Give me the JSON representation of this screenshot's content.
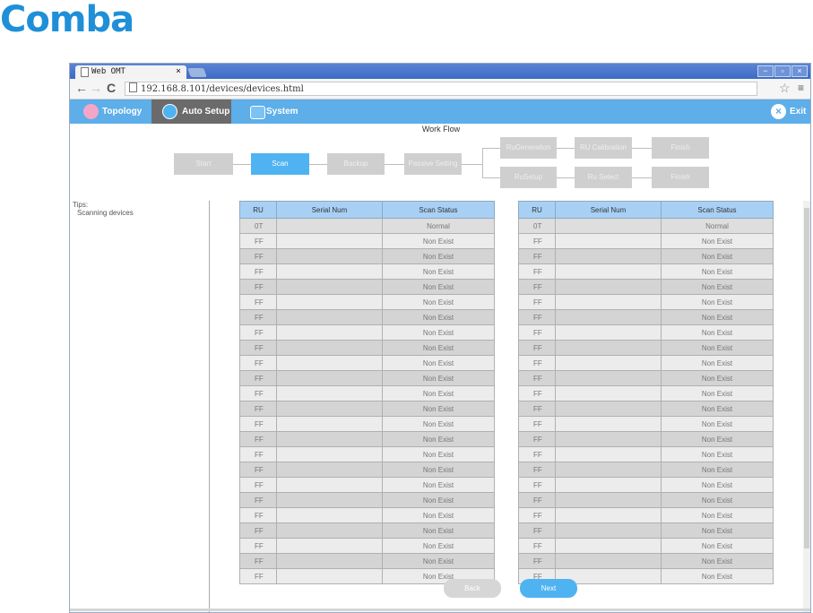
{
  "brand": {
    "logo_text": "Comba",
    "color": "#1f8fd8"
  },
  "browser": {
    "tab_title": "Web OMT",
    "tab_close": "×",
    "url": "192.168.8.101/devices/devices.html",
    "window_buttons": [
      "−",
      "▫",
      "×"
    ]
  },
  "menu": {
    "topology": "Topology",
    "auto_setup": "Auto Setup",
    "system": "System",
    "exit": "Exit"
  },
  "workflow": {
    "title": "Work Flow",
    "steps": {
      "start": "Start",
      "scan": "Scan",
      "backup": "Backup",
      "passive_setting": "Passive Setting",
      "ru_generation": "RuGeneration",
      "ru_calibration": "RU Calibration",
      "finish1": "Finish",
      "ru_setup": "RuSetup",
      "ru_select": "Ru Select",
      "finish2": "Finish"
    }
  },
  "tips": {
    "label": "Tips:",
    "text": "Scanning devices"
  },
  "table_headers": [
    "RU",
    "Serial Num",
    "Scan Status"
  ],
  "left_table": [
    [
      "0T",
      "",
      "Normal"
    ],
    [
      "FF",
      "",
      "Non Exist"
    ],
    [
      "FF",
      "",
      "Non Exist"
    ],
    [
      "FF",
      "",
      "Non Exist"
    ],
    [
      "FF",
      "",
      "Non Exist"
    ],
    [
      "FF",
      "",
      "Non Exist"
    ],
    [
      "FF",
      "",
      "Non Exist"
    ],
    [
      "FF",
      "",
      "Non Exist"
    ],
    [
      "FF",
      "",
      "Non Exist"
    ],
    [
      "FF",
      "",
      "Non Exist"
    ],
    [
      "FF",
      "",
      "Non Exist"
    ],
    [
      "FF",
      "",
      "Non Exist"
    ],
    [
      "FF",
      "",
      "Non Exist"
    ],
    [
      "FF",
      "",
      "Non Exist"
    ],
    [
      "FF",
      "",
      "Non Exist"
    ],
    [
      "FF",
      "",
      "Non Exist"
    ],
    [
      "FF",
      "",
      "Non Exist"
    ],
    [
      "FF",
      "",
      "Non Exist"
    ],
    [
      "FF",
      "",
      "Non Exist"
    ],
    [
      "FF",
      "",
      "Non Exist"
    ],
    [
      "FF",
      "",
      "Non Exist"
    ],
    [
      "FF",
      "",
      "Non Exist"
    ],
    [
      "FF",
      "",
      "Non Exist"
    ],
    [
      "FF",
      "",
      "Non Exist"
    ]
  ],
  "right_table": [
    [
      "0T",
      "",
      "Normal"
    ],
    [
      "FF",
      "",
      "Non Exist"
    ],
    [
      "FF",
      "",
      "Non Exist"
    ],
    [
      "FF",
      "",
      "Non Exist"
    ],
    [
      "FF",
      "",
      "Non Exist"
    ],
    [
      "FF",
      "",
      "Non Exist"
    ],
    [
      "FF",
      "",
      "Non Exist"
    ],
    [
      "FF",
      "",
      "Non Exist"
    ],
    [
      "FF",
      "",
      "Non Exist"
    ],
    [
      "FF",
      "",
      "Non Exist"
    ],
    [
      "FF",
      "",
      "Non Exist"
    ],
    [
      "FF",
      "",
      "Non Exist"
    ],
    [
      "FF",
      "",
      "Non Exist"
    ],
    [
      "FF",
      "",
      "Non Exist"
    ],
    [
      "FF",
      "",
      "Non Exist"
    ],
    [
      "FF",
      "",
      "Non Exist"
    ],
    [
      "FF",
      "",
      "Non Exist"
    ],
    [
      "FF",
      "",
      "Non Exist"
    ],
    [
      "FF",
      "",
      "Non Exist"
    ],
    [
      "FF",
      "",
      "Non Exist"
    ],
    [
      "FF",
      "",
      "Non Exist"
    ],
    [
      "FF",
      "",
      "Non Exist"
    ],
    [
      "FF",
      "",
      "Non Exist"
    ],
    [
      "FF",
      "",
      "Non Exist"
    ]
  ],
  "buttons": {
    "back": "Back",
    "next": "Next"
  },
  "colors": {
    "menubar": "#5daee9",
    "active_step": "#4fb3f2",
    "inactive_step": "#cfcfcf",
    "header": "#a8d0f5"
  }
}
